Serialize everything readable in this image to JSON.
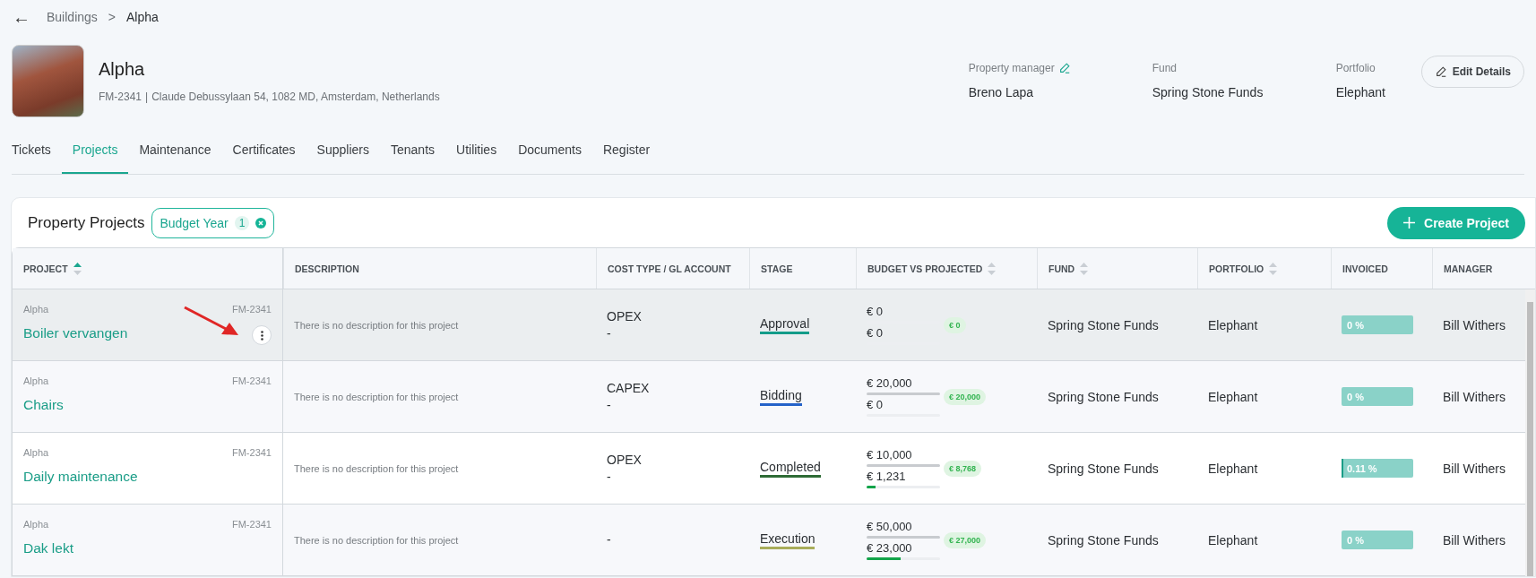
{
  "breadcrumb": {
    "back": "←",
    "items": [
      "Buildings",
      "Alpha"
    ],
    "separator": ">"
  },
  "building": {
    "name": "Alpha",
    "code": "FM-2341",
    "separator": "|",
    "address": "Claude Debussylaan 54, 1082 MD, Amsterdam, Netherlands"
  },
  "details": [
    {
      "label": "Property manager",
      "value": "Breno Lapa",
      "editable": true
    },
    {
      "label": "Fund",
      "value": "Spring Stone Funds",
      "editable": false
    },
    {
      "label": "Portfolio",
      "value": "Elephant",
      "editable": false
    }
  ],
  "edit_button": "Edit Details",
  "tabs": [
    {
      "label": "Tickets",
      "selected": false
    },
    {
      "label": "Projects",
      "selected": true
    },
    {
      "label": "Maintenance",
      "selected": false
    },
    {
      "label": "Certificates",
      "selected": false
    },
    {
      "label": "Suppliers",
      "selected": false
    },
    {
      "label": "Tenants",
      "selected": false
    },
    {
      "label": "Utilities",
      "selected": false
    },
    {
      "label": "Documents",
      "selected": false
    },
    {
      "label": "Register",
      "selected": false
    }
  ],
  "card": {
    "title": "Property Projects",
    "filter": {
      "label": "Budget Year",
      "count": "1"
    },
    "create_button": "Create Project"
  },
  "table": {
    "columns": [
      {
        "label": "PROJECT",
        "sortable": true,
        "sorted": true
      },
      {
        "label": "DESCRIPTION",
        "sortable": false
      },
      {
        "label": "COST TYPE / GL ACCOUNT",
        "sortable": false
      },
      {
        "label": "STAGE",
        "sortable": false
      },
      {
        "label": "BUDGET VS PROJECTED",
        "sortable": true,
        "sorted": false
      },
      {
        "label": "FUND",
        "sortable": true,
        "sorted": false
      },
      {
        "label": "PORTFOLIO",
        "sortable": true,
        "sorted": false
      },
      {
        "label": "INVOICED",
        "sortable": false
      },
      {
        "label": "MANAGER",
        "sortable": false
      }
    ],
    "rows": [
      {
        "selected": true,
        "building": "Alpha",
        "code": "FM-2341",
        "name": "Boiler vervangen",
        "description": "There is no description for this project",
        "cost_type": "OPEX",
        "gl_account": "-",
        "stage": "Approval",
        "color": "#139c8a",
        "budget": {
          "value": "€ 0",
          "level": 0
        },
        "projected": {
          "value": "€ 0",
          "level": 0
        },
        "remaining": "€ 0",
        "fund": "Spring Stone Funds",
        "portfolio": "Elephant",
        "invoiced": {
          "value": "0 %",
          "level": 0
        },
        "manager": "Bill Withers"
      },
      {
        "selected": false,
        "building": "Alpha",
        "code": "FM-2341",
        "name": "Chairs",
        "description": "There is no description for this project",
        "cost_type": "CAPEX",
        "gl_account": "-",
        "stage": "Bidding",
        "color": "#2563c9",
        "budget": {
          "value": "€ 20,000",
          "level": 1
        },
        "projected": {
          "value": "€ 0",
          "level": 0
        },
        "remaining": "€ 20,000",
        "fund": "Spring Stone Funds",
        "portfolio": "Elephant",
        "invoiced": {
          "value": "0 %",
          "level": 0
        },
        "manager": "Bill Withers"
      },
      {
        "selected": false,
        "building": "Alpha",
        "code": "FM-2341",
        "name": "Daily maintenance",
        "description": "There is no description for this project",
        "cost_type": "OPEX",
        "gl_account": "-",
        "stage": "Completed",
        "color": "#2e6b35",
        "budget": {
          "value": "€ 10,000",
          "level": 1
        },
        "projected": {
          "value": "€ 1,231",
          "level": 0.12
        },
        "remaining": "€ 8,768",
        "fund": "Spring Stone Funds",
        "portfolio": "Elephant",
        "invoiced": {
          "value": "0.11 %",
          "level": 0.0011
        },
        "manager": "Bill Withers"
      },
      {
        "selected": false,
        "building": "Alpha",
        "code": "FM-2341",
        "name": "Dak lekt",
        "description": "There is no description for this project",
        "cost_type": "-",
        "stage": "Execution",
        "color": "#a9ad5a",
        "budget": {
          "value": "€ 50,000",
          "level": 1
        },
        "projected": {
          "value": "€ 23,000",
          "level": 0.46
        },
        "remaining": "€ 27,000",
        "fund": "Spring Stone Funds",
        "portfolio": "Elephant",
        "invoiced": {
          "value": "0 %",
          "level": 0
        },
        "manager": "Bill Withers"
      }
    ]
  }
}
